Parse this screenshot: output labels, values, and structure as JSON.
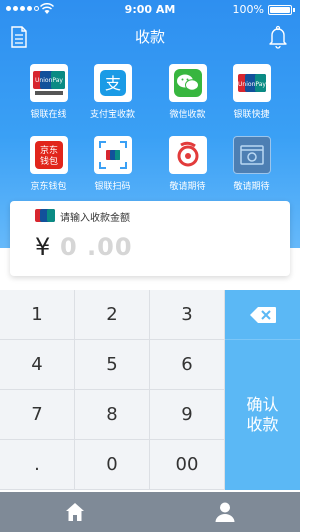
{
  "status_bar": {
    "time": "9:00 AM",
    "battery": "100%"
  },
  "nav": {
    "title": "收款",
    "left_icon": "document-icon",
    "right_icon": "bell-icon"
  },
  "grid": [
    {
      "label": "银联在线",
      "icon": "unionpay-online-icon"
    },
    {
      "label": "支付宝收款",
      "icon": "alipay-icon"
    },
    {
      "label": "微信收款",
      "icon": "wechat-icon"
    },
    {
      "label": "银联快捷",
      "icon": "unionpay-quick-icon"
    },
    {
      "label": "京东钱包",
      "icon": "jd-wallet-icon"
    },
    {
      "label": "银联扫码",
      "icon": "unionpay-scan-icon"
    },
    {
      "label": "敬请期待",
      "icon": "coming-soon-icon"
    },
    {
      "label": "敬请期待",
      "icon": "coming-soon-icon"
    }
  ],
  "amount": {
    "hint": "请输入收款金额",
    "currency": "¥",
    "placeholder": "0 .00"
  },
  "keypad": {
    "keys": [
      "1",
      "2",
      "3",
      "4",
      "5",
      "6",
      "7",
      "8",
      "9",
      ".",
      "0",
      "00"
    ],
    "confirm_label": "确认收款"
  },
  "colors": {
    "primary": "#3aa0f5",
    "accent": "#5bb8f5",
    "tabbar": "#7f8a97"
  },
  "tabs": [
    {
      "icon": "home-icon"
    },
    {
      "icon": "user-icon"
    }
  ]
}
